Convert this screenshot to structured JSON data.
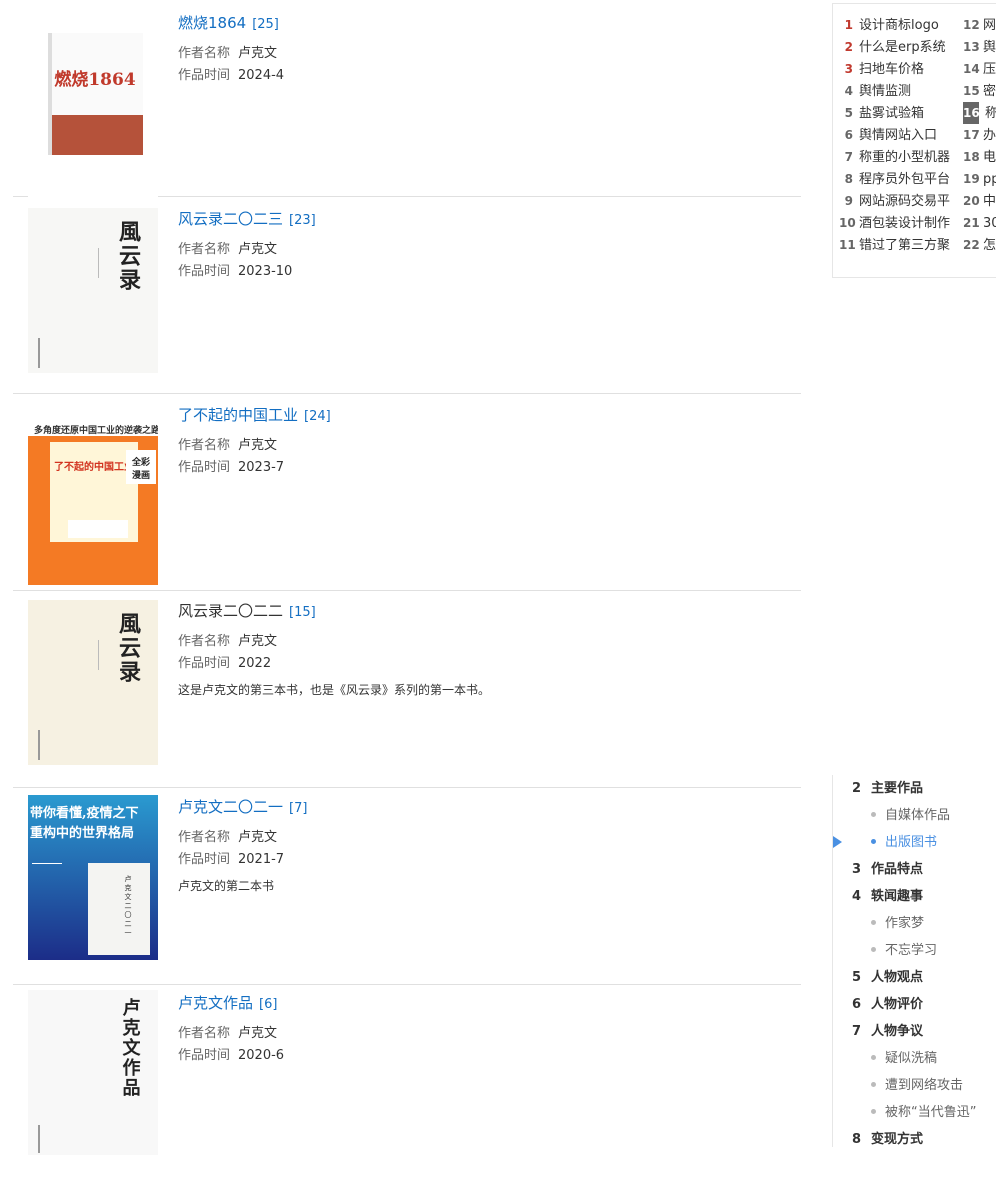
{
  "books": [
    {
      "title": "燃烧1864",
      "count": "[25]",
      "author_label": "作者名称",
      "author": "卢克文",
      "time_label": "作品时间",
      "time": "2024-4",
      "desc": "",
      "linked": true,
      "cover": {
        "bg": "#ffffff",
        "text": "燃烧1864",
        "color": "#c0392b",
        "band": "#b5523a"
      }
    },
    {
      "title": "风云录二〇二三",
      "count": "[23]",
      "author_label": "作者名称",
      "author": "卢克文",
      "time_label": "作品时间",
      "time": "2023-10",
      "desc": "",
      "linked": true,
      "cover": {
        "bg": "#f7f7f5",
        "text": "風云录",
        "color": "#222222"
      }
    },
    {
      "title": "了不起的中国工业",
      "count": "[24]",
      "author_label": "作者名称",
      "author": "卢克文",
      "time_label": "作品时间",
      "time": "2023-7",
      "desc": "",
      "linked": true,
      "cover": {
        "bg": "#f47a24",
        "text": "了不起的中国工业",
        "banner": "多角度还原中国工业的逆袭之路",
        "tag": "全彩漫画",
        "color": "#ffffff"
      }
    },
    {
      "title": "风云录二〇二二",
      "count": "[15]",
      "author_label": "作者名称",
      "author": "卢克文",
      "time_label": "作品时间",
      "time": "2022",
      "desc": "这是卢克文的第三本书，也是《风云录》系列的第一本书。",
      "linked": false,
      "cover": {
        "bg": "#f6f1e2",
        "text": "風云录",
        "color": "#222222"
      }
    },
    {
      "title": "卢克文二〇二一",
      "count": "[7]",
      "author_label": "作者名称",
      "author": "卢克文",
      "time_label": "作品时间",
      "time": "2021-7",
      "desc": "卢克文的第二本书",
      "linked": true,
      "cover": {
        "bg": "#1e3f9a",
        "text": "带你看懂,疫情之下重构中的世界格局",
        "color": "#ffffff"
      }
    },
    {
      "title": "卢克文作品",
      "count": "[6]",
      "author_label": "作者名称",
      "author": "卢克文",
      "time_label": "作品时间",
      "time": "2020-6",
      "desc": "",
      "linked": true,
      "cover": {
        "bg": "#f8f8f8",
        "text": "卢克文作品",
        "color": "#222222"
      }
    }
  ],
  "hot_list": {
    "left": [
      {
        "num": "1",
        "label": "设计商标logo"
      },
      {
        "num": "2",
        "label": "什么是erp系统"
      },
      {
        "num": "3",
        "label": "扫地车价格"
      },
      {
        "num": "4",
        "label": "舆情监测"
      },
      {
        "num": "5",
        "label": "盐雾试验箱"
      },
      {
        "num": "6",
        "label": "舆情网站入口"
      },
      {
        "num": "7",
        "label": "称重的小型机器"
      },
      {
        "num": "8",
        "label": "程序员外包平台"
      },
      {
        "num": "9",
        "label": "网站源码交易平"
      },
      {
        "num": "10",
        "label": "酒包装设计制作"
      },
      {
        "num": "11",
        "label": "错过了第三方聚"
      }
    ],
    "right": [
      {
        "num": "12",
        "label": "网"
      },
      {
        "num": "13",
        "label": "舆"
      },
      {
        "num": "14",
        "label": "压"
      },
      {
        "num": "15",
        "label": "密"
      },
      {
        "num": "16",
        "label": "称"
      },
      {
        "num": "17",
        "label": "办"
      },
      {
        "num": "18",
        "label": "电"
      },
      {
        "num": "19",
        "label": "pp"
      },
      {
        "num": "20",
        "label": "中"
      },
      {
        "num": "21",
        "label": "30"
      },
      {
        "num": "22",
        "label": "怎"
      }
    ]
  },
  "outline": [
    {
      "num": "2",
      "label": "主要作品",
      "sub": false
    },
    {
      "num": "",
      "label": "自媒体作品",
      "sub": true
    },
    {
      "num": "",
      "label": "出版图书",
      "sub": true,
      "active": true
    },
    {
      "num": "3",
      "label": "作品特点",
      "sub": false
    },
    {
      "num": "4",
      "label": "轶闻趣事",
      "sub": false
    },
    {
      "num": "",
      "label": "作家梦",
      "sub": true
    },
    {
      "num": "",
      "label": "不忘学习",
      "sub": true
    },
    {
      "num": "5",
      "label": "人物观点",
      "sub": false
    },
    {
      "num": "6",
      "label": "人物评价",
      "sub": false
    },
    {
      "num": "7",
      "label": "人物争议",
      "sub": false
    },
    {
      "num": "",
      "label": "疑似洗稿",
      "sub": true
    },
    {
      "num": "",
      "label": "遭到网络攻击",
      "sub": true
    },
    {
      "num": "",
      "label": "被称“当代鲁迅”",
      "sub": true
    },
    {
      "num": "8",
      "label": "变现方式",
      "sub": false
    }
  ]
}
